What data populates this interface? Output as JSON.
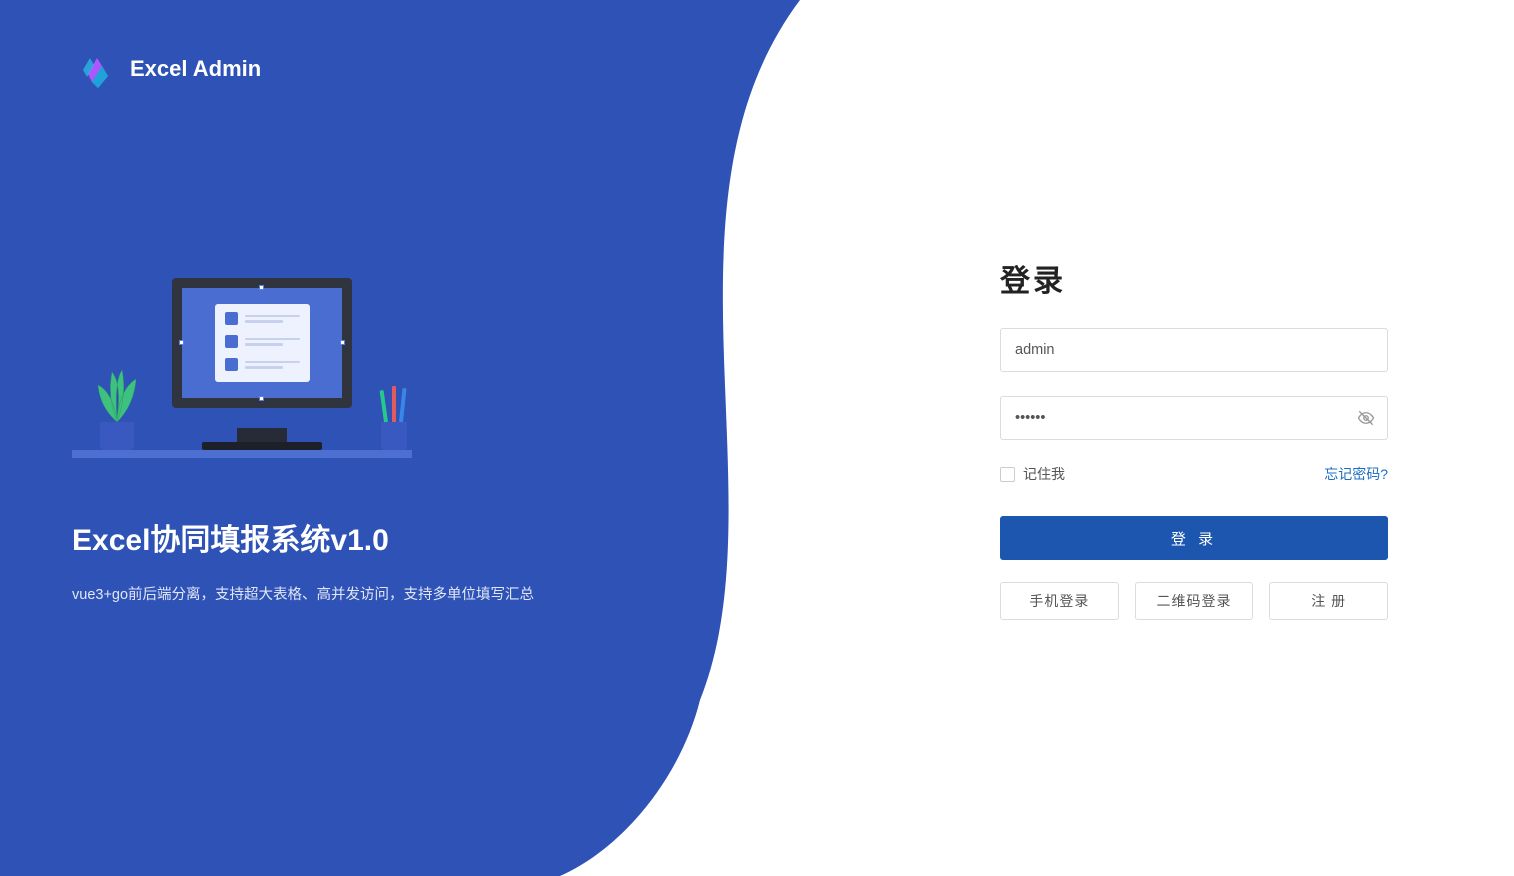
{
  "brand": {
    "name": "Excel Admin"
  },
  "promo": {
    "title": "Excel协同填报系统v1.0",
    "subtitle": "vue3+go前后端分离，支持超大表格、高并发访问，支持多单位填写汇总"
  },
  "login": {
    "title": "登录",
    "username_value": "admin",
    "password_value": "••••••",
    "remember_label": "记住我",
    "forgot_label": "忘记密码?",
    "submit_label": "登 录",
    "alt_phone": "手机登录",
    "alt_qr": "二维码登录",
    "alt_register": "注 册"
  },
  "colors": {
    "primary": "#2e52b6",
    "button": "#1d56ae",
    "link": "#1b6ec2"
  }
}
